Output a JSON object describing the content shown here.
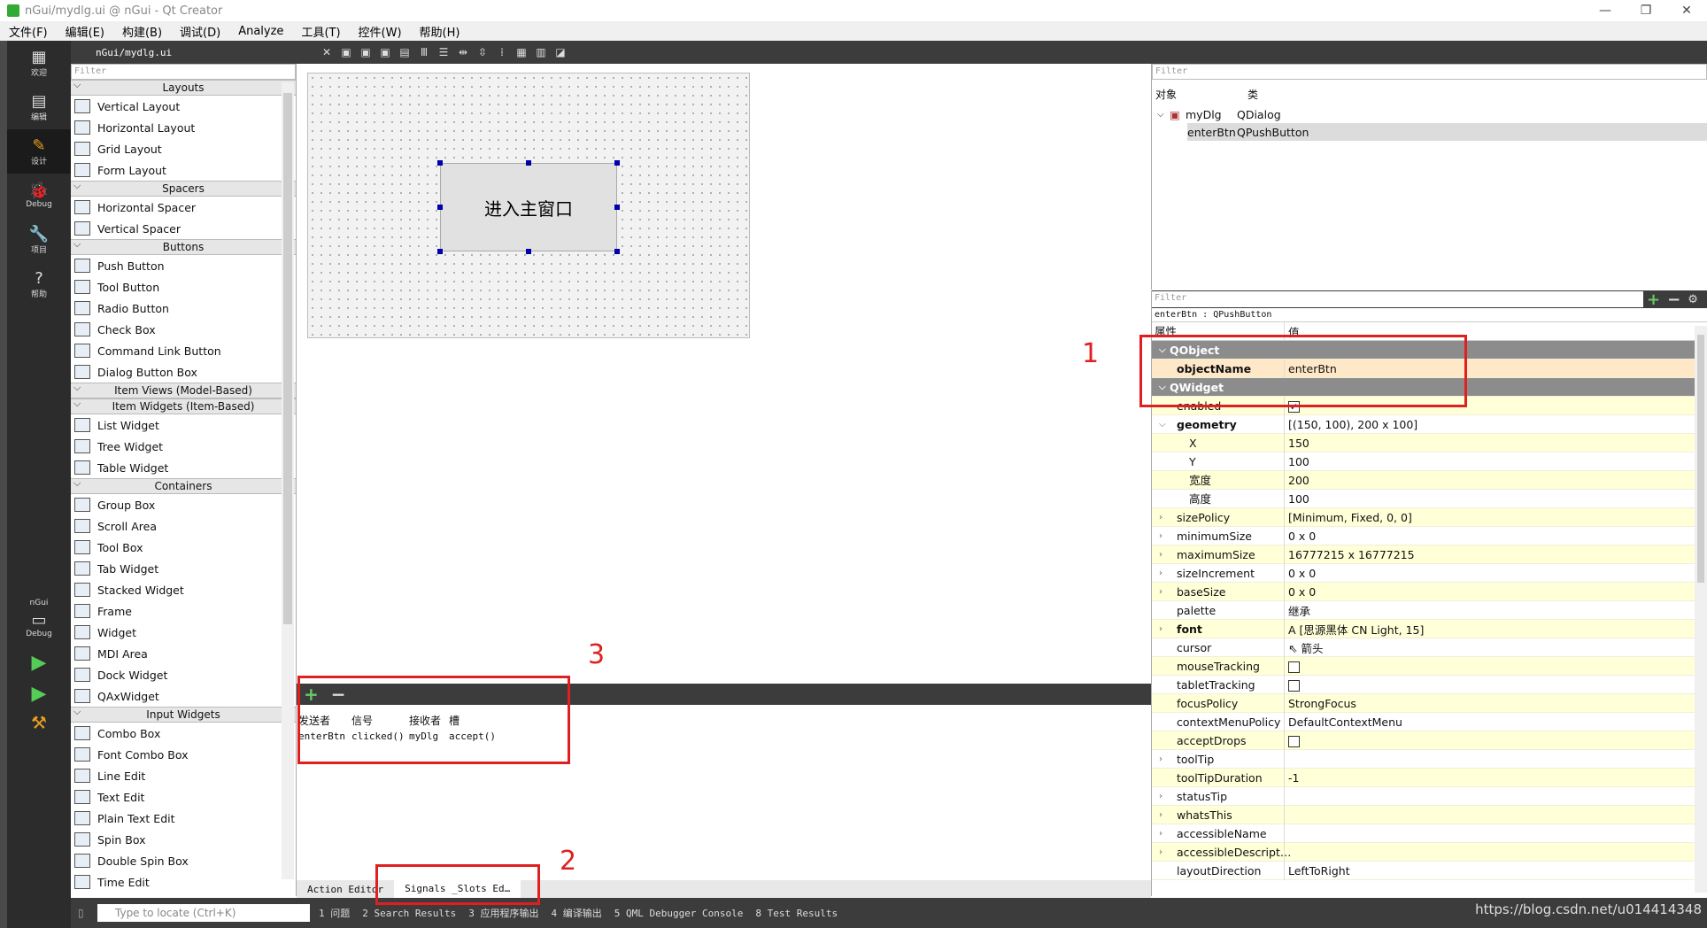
{
  "window": {
    "title": "nGui/mydlg.ui @ nGui - Qt Creator",
    "buttons": [
      "—",
      "❐",
      "✕"
    ]
  },
  "menu": [
    "文件(F)",
    "编辑(E)",
    "构建(B)",
    "调试(D)",
    "Analyze",
    "工具(T)",
    "控件(W)",
    "帮助(H)"
  ],
  "modes": [
    {
      "icon": "▦",
      "label": "欢迎"
    },
    {
      "icon": "▤",
      "label": "编辑"
    },
    {
      "icon": "✎",
      "label": "设计"
    },
    {
      "icon": "🐞",
      "label": "Debug"
    },
    {
      "icon": "🔧",
      "label": "项目"
    },
    {
      "icon": "?",
      "label": "帮助"
    }
  ],
  "kit": {
    "project": "nGui",
    "label": "Debug"
  },
  "toolbar": {
    "file": "nGui/mydlg.ui"
  },
  "widgetbox": {
    "filter": "Filter",
    "sections": [
      {
        "name": "Layouts",
        "items": [
          "Vertical Layout",
          "Horizontal Layout",
          "Grid Layout",
          "Form Layout"
        ]
      },
      {
        "name": "Spacers",
        "items": [
          "Horizontal Spacer",
          "Vertical Spacer"
        ]
      },
      {
        "name": "Buttons",
        "items": [
          "Push Button",
          "Tool Button",
          "Radio Button",
          "Check Box",
          "Command Link Button",
          "Dialog Button Box"
        ]
      },
      {
        "name": "Item Views (Model-Based)",
        "items": []
      },
      {
        "name": "Item Widgets (Item-Based)",
        "items": [
          "List Widget",
          "Tree Widget",
          "Table Widget"
        ]
      },
      {
        "name": "Containers",
        "items": [
          "Group Box",
          "Scroll Area",
          "Tool Box",
          "Tab Widget",
          "Stacked Widget",
          "Frame",
          "Widget",
          "MDI Area",
          "Dock Widget",
          "QAxWidget"
        ]
      },
      {
        "name": "Input Widgets",
        "items": [
          "Combo Box",
          "Font Combo Box",
          "Line Edit",
          "Text Edit",
          "Plain Text Edit",
          "Spin Box",
          "Double Spin Box",
          "Time Edit"
        ]
      }
    ]
  },
  "form": {
    "button_text": "进入主窗口"
  },
  "signals": {
    "headers": [
      "发送者",
      "信号",
      "接收者",
      "槽"
    ],
    "rows": [
      {
        "sender": "enterBtn",
        "signal": "clicked()",
        "receiver": "myDlg",
        "slot": "accept()"
      }
    ]
  },
  "bottom_tabs": [
    "Action Editor",
    "Signals _Slots Ed…"
  ],
  "object_inspector": {
    "filter": "Filter",
    "headers": [
      "对象",
      "类"
    ],
    "rows": [
      {
        "object": "myDlg",
        "class": "QDialog"
      },
      {
        "object": "enterBtn",
        "class": "QPushButton"
      }
    ]
  },
  "property_editor": {
    "filter": "Filter",
    "class_line": "enterBtn : QPushButton",
    "headers": [
      "属性",
      "值"
    ],
    "rows": [
      {
        "name": "QObject",
        "value": "",
        "kind": "sec"
      },
      {
        "name": "objectName",
        "value": "enterBtn",
        "kind": "obj"
      },
      {
        "name": "QWidget",
        "value": "",
        "kind": "sec"
      },
      {
        "name": "enabled",
        "value": "",
        "kind": "check",
        "checked": true
      },
      {
        "name": "geometry",
        "value": "[(150, 100), 200 x 100]",
        "kind": "bold",
        "expand": "open"
      },
      {
        "name": "X",
        "value": "150",
        "kind": "sub"
      },
      {
        "name": "Y",
        "value": "100",
        "kind": "sub"
      },
      {
        "name": "宽度",
        "value": "200",
        "kind": "sub"
      },
      {
        "name": "高度",
        "value": "100",
        "kind": "sub"
      },
      {
        "name": "sizePolicy",
        "value": "[Minimum, Fixed, 0, 0]",
        "expand": "closed"
      },
      {
        "name": "minimumSize",
        "value": "0 x 0",
        "expand": "closed"
      },
      {
        "name": "maximumSize",
        "value": "16777215 x 16777215",
        "expand": "closed"
      },
      {
        "name": "sizeIncrement",
        "value": "0 x 0",
        "expand": "closed"
      },
      {
        "name": "baseSize",
        "value": "0 x 0",
        "expand": "closed"
      },
      {
        "name": "palette",
        "value": "继承"
      },
      {
        "name": "font",
        "value": "A  [思源黑体 CN Light, 15]",
        "kind": "bold",
        "expand": "closed"
      },
      {
        "name": "cursor",
        "value": "⇖  箭头"
      },
      {
        "name": "mouseTracking",
        "value": "",
        "kind": "check",
        "checked": false
      },
      {
        "name": "tabletTracking",
        "value": "",
        "kind": "check",
        "checked": false
      },
      {
        "name": "focusPolicy",
        "value": "StrongFocus"
      },
      {
        "name": "contextMenuPolicy",
        "value": "DefaultContextMenu"
      },
      {
        "name": "acceptDrops",
        "value": "",
        "kind": "check",
        "checked": false
      },
      {
        "name": "toolTip",
        "value": "",
        "expand": "closed"
      },
      {
        "name": "toolTipDuration",
        "value": "-1"
      },
      {
        "name": "statusTip",
        "value": "",
        "expand": "closed"
      },
      {
        "name": "whatsThis",
        "value": "",
        "expand": "closed"
      },
      {
        "name": "accessibleName",
        "value": "",
        "expand": "closed"
      },
      {
        "name": "accessibleDescript…",
        "value": "",
        "expand": "closed"
      },
      {
        "name": "layoutDirection",
        "value": "LeftToRight"
      }
    ]
  },
  "statusbar": {
    "locate_placeholder": "Type to locate (Ctrl+K)",
    "outputs": [
      "1 问题",
      "2 Search Results",
      "3 应用程序输出",
      "4 编译输出",
      "5 QML Debugger Console",
      "8 Test Results"
    ]
  },
  "watermark": "https://blog.csdn.net/u014414348",
  "annotations": [
    "1",
    "2",
    "3"
  ],
  "colors": {
    "accent_red": "#e02020",
    "dark_bar": "#3c3c3c",
    "highlight_yellow": "#ffffd8"
  }
}
